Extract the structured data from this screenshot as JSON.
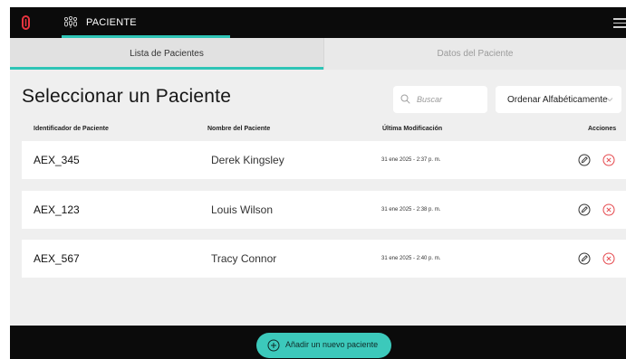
{
  "app": {
    "logo_icon": "app-logo-icon",
    "accent_color": "#2ec4b6"
  },
  "topbar": {
    "tab_label": "PACIENTE",
    "tab_icon": "patient-group-icon",
    "menu_icon": "hamburger-menu-icon"
  },
  "subtabs": [
    {
      "label": "Lista de Pacientes",
      "active": true
    },
    {
      "label": "Datos del Paciente",
      "active": false
    }
  ],
  "main": {
    "title": "Seleccionar un Paciente",
    "search": {
      "placeholder": "Buscar",
      "value": ""
    },
    "sort": {
      "selected": "Ordenar Alfabéticamente"
    }
  },
  "table": {
    "headers": {
      "id": "Identificador de Paciente",
      "name": "Nombre del Paciente",
      "modified": "Última Modificación",
      "actions": "Acciones"
    },
    "rows": [
      {
        "id": "AEX_345",
        "name": "Derek Kingsley",
        "modified": "31 ene 2025 - 2:37 p. m."
      },
      {
        "id": "AEX_123",
        "name": "Louis Wilson",
        "modified": "31 ene 2025 - 2:38 p. m."
      },
      {
        "id": "AEX_567",
        "name": "Tracy Connor",
        "modified": "31 ene 2025 - 2:40 p. m."
      }
    ]
  },
  "footer": {
    "add_label": "Añadir un nuevo paciente",
    "add_color": "#3cc9bb"
  }
}
